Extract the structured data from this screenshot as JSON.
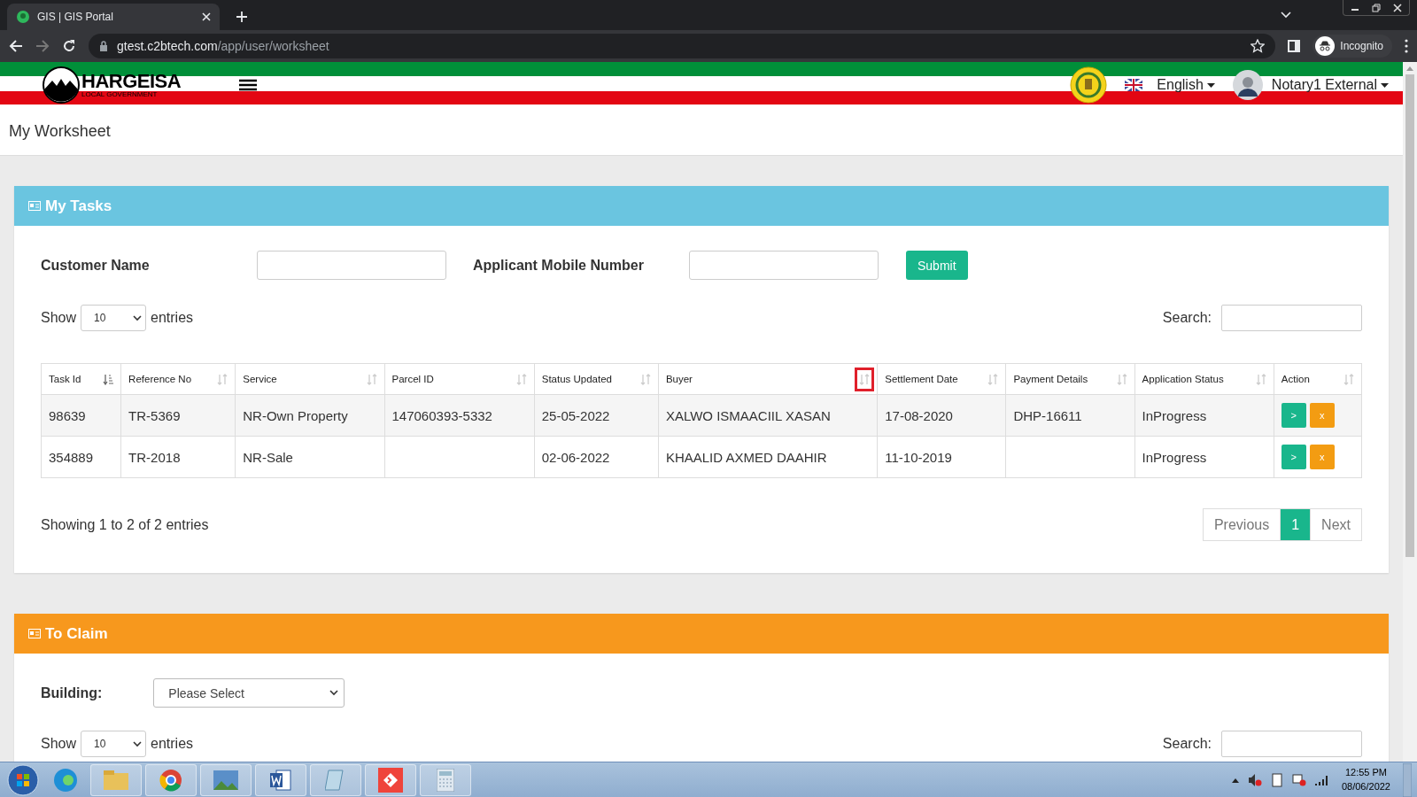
{
  "browser": {
    "tab_title": "GIS | GIS Portal",
    "url_host": "gtest.c2btech.com",
    "url_path": "/app/user/worksheet",
    "profile": "Incognito"
  },
  "header": {
    "logo_title": "HARGEISA",
    "logo_subtitle": "LOCAL GOVERNMENT",
    "language": "English",
    "user": "Notary1 External"
  },
  "page_title": "My Worksheet",
  "my_tasks": {
    "title": "My Tasks",
    "filters": [
      {
        "label": "Customer Name"
      },
      {
        "label": "Applicant Mobile Number"
      }
    ],
    "submit": "Submit",
    "show_label": "Show",
    "page_size": "10",
    "entries_label": "entries",
    "search_label": "Search:",
    "columns": [
      {
        "label": "Task Id",
        "sorted": true,
        "highlighted": false
      },
      {
        "label": "Reference No",
        "sorted": false,
        "highlighted": false
      },
      {
        "label": "Service",
        "sorted": false,
        "highlighted": false
      },
      {
        "label": "Parcel ID",
        "sorted": false,
        "highlighted": false
      },
      {
        "label": "Status Updated",
        "sorted": false,
        "highlighted": false
      },
      {
        "label": "Buyer",
        "sorted": false,
        "highlighted": true
      },
      {
        "label": "Settlement Date",
        "sorted": false,
        "highlighted": false
      },
      {
        "label": "Payment Details",
        "sorted": false,
        "highlighted": false
      },
      {
        "label": "Application Status",
        "sorted": false,
        "highlighted": false
      },
      {
        "label": "Action",
        "sorted": false,
        "highlighted": false
      }
    ],
    "rows": [
      {
        "cells": [
          "98639",
          "TR-5369",
          "NR-Own Property",
          "147060393-5332",
          "25-05-2022",
          "XALWO ISMAACIIL XASAN",
          "17-08-2020",
          "DHP-16611",
          "InProgress"
        ],
        "actions": [
          ">",
          "x"
        ]
      },
      {
        "cells": [
          "354889",
          "TR-2018",
          "NR-Sale",
          "",
          "02-06-2022",
          "KHAALID AXMED DAAHIR",
          "11-10-2019",
          "",
          "InProgress"
        ],
        "actions": [
          ">",
          "x"
        ]
      }
    ],
    "info": "Showing 1 to 2 of 2 entries",
    "pagination": [
      {
        "label": "Previous",
        "selected": false
      },
      {
        "label": "1",
        "selected": true
      },
      {
        "label": "Next",
        "selected": false
      }
    ]
  },
  "to_claim": {
    "title": "To Claim",
    "building_label": "Building:",
    "building_value": "Please Select",
    "show_label": "Show",
    "page_size": "10",
    "entries_label": "entries",
    "search_label": "Search:"
  },
  "taskbar": {
    "time": "12:55 PM",
    "date": "08/06/2022"
  }
}
